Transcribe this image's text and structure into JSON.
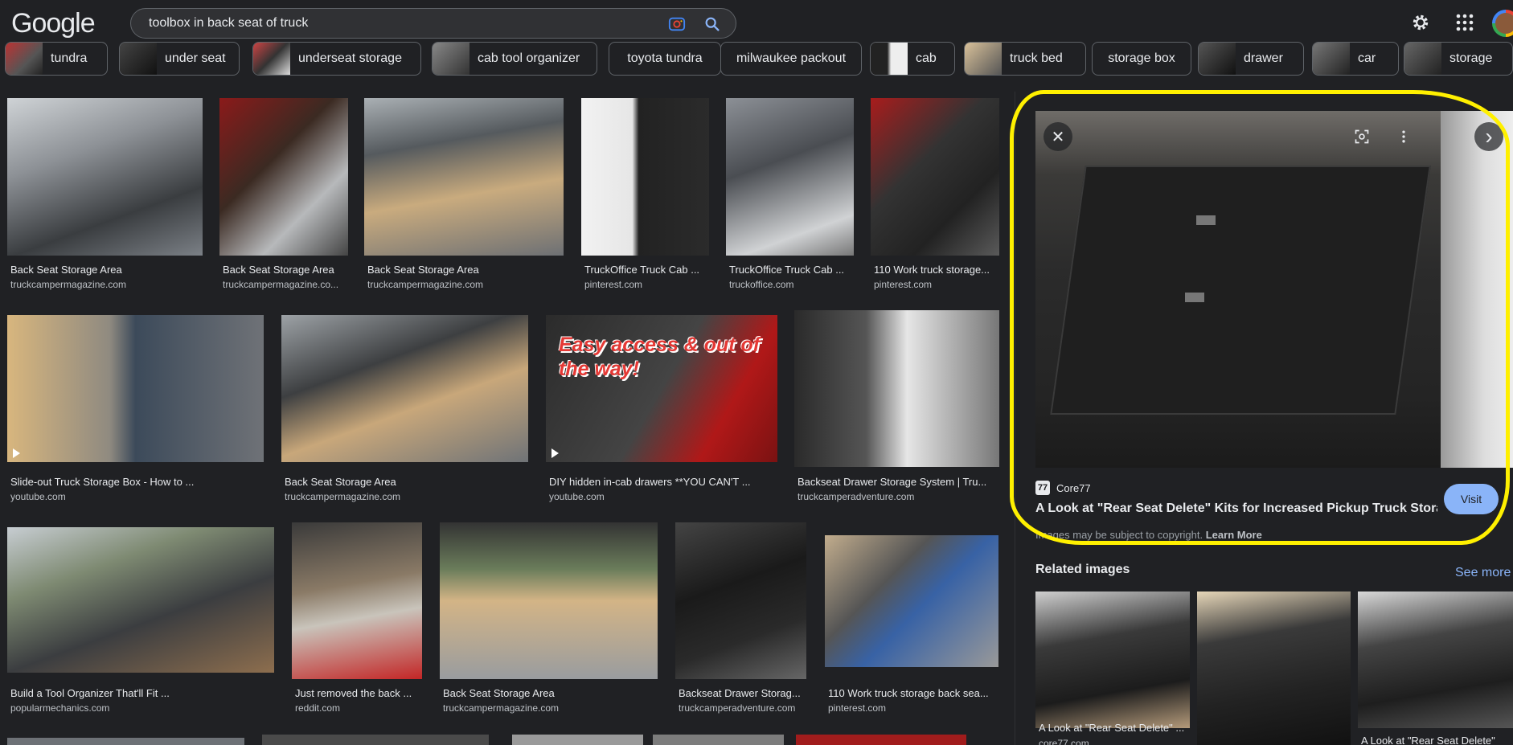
{
  "header": {
    "logo": "Google",
    "query": "toolbox in back seat of truck"
  },
  "icons": {
    "lens": "camera-lens-icon",
    "search": "search-icon",
    "settings": "gear-icon",
    "apps": "apps-grid-icon"
  },
  "colors": {
    "accent": "#8ab4f8",
    "background": "#202124",
    "annotation": "#fff000"
  },
  "chips": [
    {
      "label": "tundra"
    },
    {
      "label": "under seat"
    },
    {
      "label": "underseat storage"
    },
    {
      "label": "cab tool organizer"
    },
    {
      "label": "toyota tundra"
    },
    {
      "label": "milwaukee packout"
    },
    {
      "label": "cab"
    },
    {
      "label": "truck bed"
    },
    {
      "label": "storage box"
    },
    {
      "label": "drawer"
    },
    {
      "label": "car"
    },
    {
      "label": "storage"
    }
  ],
  "results": [
    {
      "title": "Back Seat Storage Area",
      "source": "truckcampermagazine.com"
    },
    {
      "title": "Back Seat Storage Area",
      "source": "truckcampermagazine.co..."
    },
    {
      "title": "Back Seat Storage Area",
      "source": "truckcampermagazine.com"
    },
    {
      "title": "TruckOffice Truck Cab ...",
      "source": "pinterest.com"
    },
    {
      "title": "TruckOffice Truck Cab ...",
      "source": "truckoffice.com"
    },
    {
      "title": "110 Work truck storage...",
      "source": "pinterest.com"
    },
    {
      "title": "Slide-out Truck Storage Box - How to ...",
      "source": "youtube.com"
    },
    {
      "title": "Back Seat Storage Area",
      "source": "truckcampermagazine.com"
    },
    {
      "title": "DIY hidden in-cab drawers **YOU CAN'T ...",
      "source": "youtube.com",
      "overlay": "Easy access & out of the way!"
    },
    {
      "title": "Backseat Drawer Storage System | Tru...",
      "source": "truckcamperadventure.com"
    },
    {
      "title": "Build a Tool Organizer That'll Fit ...",
      "source": "popularmechanics.com"
    },
    {
      "title": "Just removed the back ...",
      "source": "reddit.com"
    },
    {
      "title": "Back Seat Storage Area",
      "source": "truckcampermagazine.com"
    },
    {
      "title": "Backseat Drawer Storag...",
      "source": "truckcamperadventure.com"
    },
    {
      "title": "110 Work truck storage back sea...",
      "source": "pinterest.com"
    }
  ],
  "preview": {
    "site": "Core77",
    "title": "A Look at \"Rear Seat Delete\" Kits for Increased Pickup Truck Stora...",
    "visit": "Visit",
    "copyright": "Images may be subject to copyright.",
    "learn_more": "Learn More",
    "close": "✕",
    "next": "›"
  },
  "related": {
    "heading": "Related images",
    "see_more": "See more",
    "items": [
      {
        "title": "A Look at \"Rear Seat Delete\" ...",
        "source": "core77.com"
      },
      {
        "title": "",
        "source": ""
      },
      {
        "title": "A Look at \"Rear Seat Delete\"",
        "source": ""
      }
    ]
  }
}
